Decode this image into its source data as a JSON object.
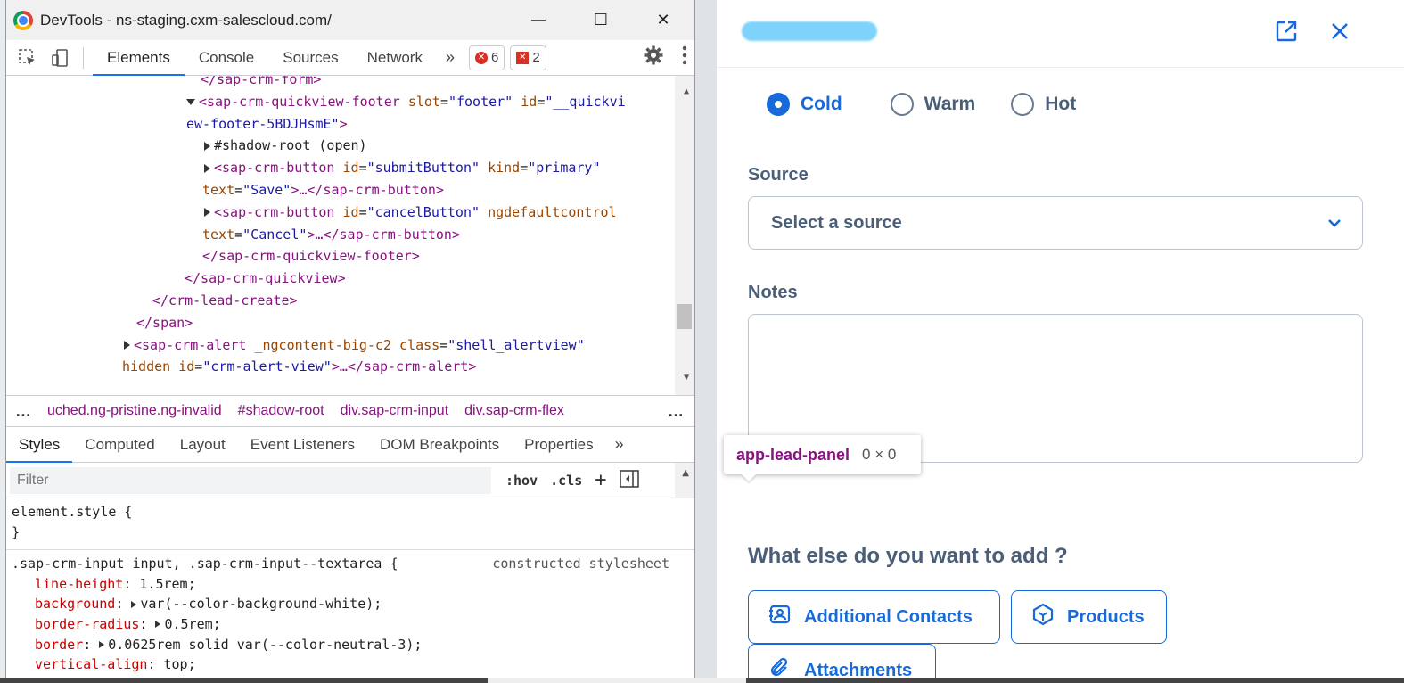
{
  "devtools": {
    "title": "DevTools - ns-staging.cxm-salescloud.com/",
    "window": {
      "minimize": "—",
      "maximize": "☐",
      "close": "✕"
    },
    "tabs": [
      "Elements",
      "Console",
      "Sources",
      "Network"
    ],
    "more": "»",
    "errors": "6",
    "issues": "2",
    "elements_lines": {
      "l1_tag": "</sap-crm-form>",
      "l2_open": "<sap-crm-quickview-footer",
      "l2_a1n": "slot",
      "l2_a1v": "\"footer\"",
      "l2_a2n": "id",
      "l2_a2v": "\"__quickvi",
      "l3": "ew-footer-5BDJHsmE\"",
      "l3_end": ">",
      "l4": "#shadow-root (open)",
      "l5_open": "<sap-crm-button",
      "l5_a1n": "id",
      "l5_a1v": "\"submitButton\"",
      "l5_a2n": "kind",
      "l5_a2v": "\"primary\"",
      "l6_a": "text",
      "l6_v": "\"Save\"",
      "l6_end": ">…</sap-crm-button>",
      "l7_open": "<sap-crm-button",
      "l7_a1n": "id",
      "l7_a1v": "\"cancelButton\"",
      "l7_a2n": "ngdefaultcontrol",
      "l8_a": "text",
      "l8_v": "\"Cancel\"",
      "l8_end": ">…</sap-crm-button>",
      "l9": "</sap-crm-quickview-footer>",
      "l10": "</sap-crm-quickview>",
      "l11": "</crm-lead-create>",
      "l12": "</span>",
      "l13_open": "<sap-crm-alert",
      "l13_a1n": "_ngcontent-big-c2",
      "l13_a2n": "class",
      "l13_a2v": "\"shell_alertview\"",
      "l14_a1n": "hidden",
      "l14_a2n": "id",
      "l14_a2v": "\"crm-alert-view\"",
      "l14_end": ">…</sap-crm-alert>"
    },
    "breadcrumbs": [
      "uched.ng-pristine.ng-invalid",
      "#shadow-root",
      "div.sap-crm-input",
      "div.sap-crm-flex"
    ],
    "crumb_more": "…",
    "styles_tabs": [
      "Styles",
      "Computed",
      "Layout",
      "Event Listeners",
      "DOM Breakpoints",
      "Properties"
    ],
    "filter_placeholder": "Filter",
    "filter_tools": {
      "hov": ":hov",
      "cls": ".cls",
      "plus": "+"
    },
    "styles": {
      "element_style": "element.style {",
      "close_brace": "}",
      "rule_selector": ".sap-crm-input input, .sap-crm-input--textarea {",
      "rule_source": "constructed stylesheet",
      "props": [
        {
          "name": "line-height",
          "value": "1.5rem;"
        },
        {
          "name": "background",
          "value": "var(--color-background-white);"
        },
        {
          "name": "border-radius",
          "value": "0.5rem;"
        },
        {
          "name": "border",
          "value": "0.0625rem solid var(--color-neutral-3);"
        },
        {
          "name": "vertical-align",
          "value": "top;"
        }
      ]
    }
  },
  "panel": {
    "radios": [
      {
        "label": "Cold",
        "checked": true
      },
      {
        "label": "Warm",
        "checked": false
      },
      {
        "label": "Hot",
        "checked": false
      }
    ],
    "source_label": "Source",
    "source_placeholder": "Select a source",
    "notes_label": "Notes",
    "add_title": "What else do you want to add ?",
    "add_buttons": {
      "contacts": "Additional Contacts",
      "products": "Products",
      "attachments": "Attachments"
    },
    "accent": "#1869d9"
  },
  "tooltip": {
    "name": "app-lead-panel",
    "size": "0 × 0"
  }
}
